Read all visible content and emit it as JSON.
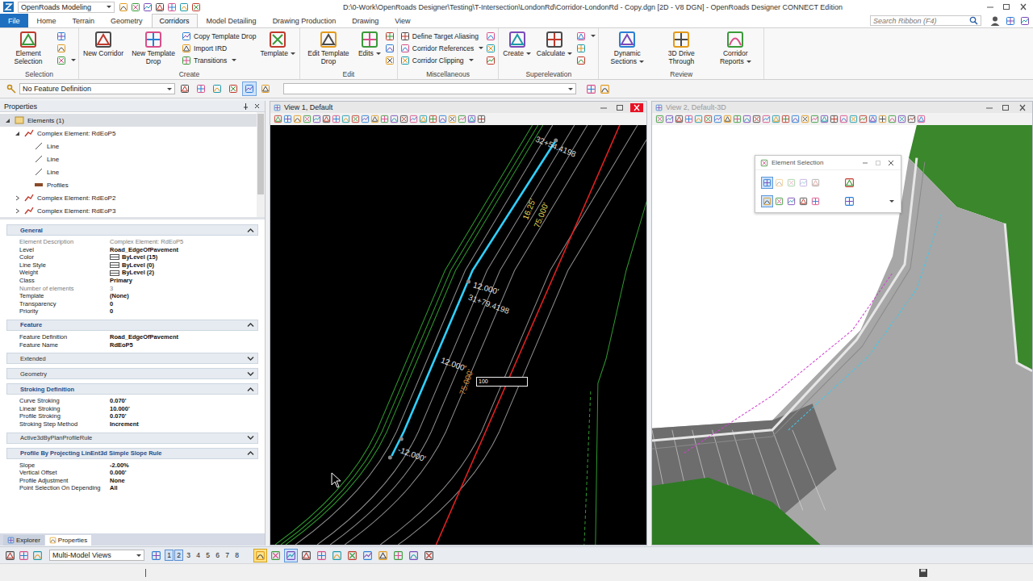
{
  "window": {
    "workflow": "OpenRoads Modeling",
    "title": "D:\\0-Work\\OpenRoads Designer\\Testing\\T-Intersection\\LondonRd\\Corridor-LondonRd - Copy.dgn [2D - V8 DGN] - OpenRoads Designer CONNECT Edition"
  },
  "ribbon_tabs": [
    {
      "label": "File",
      "kind": "file",
      "selected": false
    },
    {
      "label": "Home",
      "kind": "tab",
      "selected": false
    },
    {
      "label": "Terrain",
      "kind": "tab",
      "selected": false
    },
    {
      "label": "Geometry",
      "kind": "tab",
      "selected": false
    },
    {
      "label": "Corridors",
      "kind": "tab",
      "selected": true
    },
    {
      "label": "Model Detailing",
      "kind": "tab",
      "selected": false
    },
    {
      "label": "Drawing Production",
      "kind": "tab",
      "selected": false
    },
    {
      "label": "Drawing",
      "kind": "tab",
      "selected": false
    },
    {
      "label": "View",
      "kind": "tab",
      "selected": false
    }
  ],
  "search": {
    "placeholder": "Search Ribbon (F4)"
  },
  "ribbon_groups": [
    {
      "name": "Selection",
      "items": [
        {
          "kind": "large",
          "label": "Element Selection",
          "dropdown": false
        },
        {
          "kind": "icon",
          "label": "",
          "dropdown": false
        },
        {
          "kind": "icon",
          "label": "",
          "dropdown": false
        },
        {
          "kind": "icon",
          "label": "",
          "dropdown": true
        }
      ]
    },
    {
      "name": "Create",
      "items": [
        {
          "kind": "large",
          "label": "New Corridor",
          "dropdown": false
        },
        {
          "kind": "large",
          "label": "New Template Drop",
          "dropdown": false
        },
        {
          "kind": "small",
          "label": "Copy Template Drop",
          "dropdown": false
        },
        {
          "kind": "small",
          "label": "Import IRD",
          "dropdown": false
        },
        {
          "kind": "small",
          "label": "Transitions",
          "dropdown": true
        },
        {
          "kind": "large",
          "label": "Template",
          "dropdown": true
        }
      ]
    },
    {
      "name": "Edit",
      "items": [
        {
          "kind": "large",
          "label": "Edit Template Drop",
          "dropdown": false
        },
        {
          "kind": "large",
          "label": "Edits",
          "dropdown": true
        },
        {
          "kind": "icon",
          "label": "",
          "dropdown": false
        },
        {
          "kind": "icon",
          "label": "",
          "dropdown": false
        },
        {
          "kind": "icon",
          "label": "",
          "dropdown": false
        }
      ]
    },
    {
      "name": "Miscellaneous",
      "items": [
        {
          "kind": "small",
          "label": "Define Target Aliasing",
          "dropdown": false
        },
        {
          "kind": "small",
          "label": "Corridor References",
          "dropdown": true
        },
        {
          "kind": "small",
          "label": "Corridor Clipping",
          "dropdown": true
        },
        {
          "kind": "icon",
          "label": "",
          "dropdown": false
        },
        {
          "kind": "icon",
          "label": "",
          "dropdown": false
        },
        {
          "kind": "icon",
          "label": "",
          "dropdown": false
        }
      ]
    },
    {
      "name": "Superelevation",
      "items": [
        {
          "kind": "large",
          "label": "Create",
          "dropdown": true
        },
        {
          "kind": "large",
          "label": "Calculate",
          "dropdown": true
        },
        {
          "kind": "icon",
          "label": "",
          "dropdown": true
        },
        {
          "kind": "icon",
          "label": "",
          "dropdown": false
        },
        {
          "kind": "icon",
          "label": "",
          "dropdown": false
        }
      ]
    },
    {
      "name": "Review",
      "items": [
        {
          "kind": "large",
          "label": "Dynamic Sections",
          "dropdown": true
        },
        {
          "kind": "large",
          "label": "3D Drive Through",
          "dropdown": false
        },
        {
          "kind": "large",
          "label": "Corridor Reports",
          "dropdown": true
        }
      ]
    }
  ],
  "attribute_bar": {
    "feature_definition": "No Feature Definition",
    "field": ""
  },
  "properties_panel": {
    "title": "Properties",
    "tree": [
      {
        "label": "Elements (1)",
        "level": 0,
        "kind": "group",
        "expanded": true,
        "selected": true
      },
      {
        "label": "Complex Element: RdEoP5",
        "level": 1,
        "kind": "complex",
        "expanded": true,
        "selected": false
      },
      {
        "label": "Line",
        "level": 2,
        "kind": "line",
        "expanded": false,
        "selected": false
      },
      {
        "label": "Line",
        "level": 2,
        "kind": "line",
        "expanded": false,
        "selected": false
      },
      {
        "label": "Line",
        "level": 2,
        "kind": "line",
        "expanded": false,
        "selected": false
      },
      {
        "label": "Profiles",
        "level": 2,
        "kind": "profiles",
        "expanded": false,
        "selected": false
      },
      {
        "label": "Complex Element: RdEoP2",
        "level": 1,
        "kind": "complex",
        "expanded": false,
        "selected": false
      },
      {
        "label": "Complex Element: RdEoP3",
        "level": 1,
        "kind": "complex",
        "expanded": false,
        "selected": false
      }
    ],
    "sections": [
      {
        "title": "General",
        "expanded": true,
        "rows": [
          {
            "label": "Element Description",
            "value": "Complex Element: RdEoP5",
            "kind": "text",
            "greyed": true
          },
          {
            "label": "Level",
            "value": "Road_EdgeOfPavement",
            "kind": "text",
            "greyed": false
          },
          {
            "label": "Color",
            "value": "ByLevel (15)",
            "kind": "swatch",
            "greyed": false
          },
          {
            "label": "Line Style",
            "value": "ByLevel (0)",
            "kind": "swatch",
            "greyed": false
          },
          {
            "label": "Weight",
            "value": "ByLevel (2)",
            "kind": "swatch",
            "greyed": false
          },
          {
            "label": "Class",
            "value": "Primary",
            "kind": "text",
            "greyed": false
          },
          {
            "label": "Number of elements",
            "value": "3",
            "kind": "text",
            "greyed": true
          },
          {
            "label": "Template",
            "value": "(None)",
            "kind": "text",
            "greyed": false
          },
          {
            "label": "Transparency",
            "value": "0",
            "kind": "text",
            "greyed": false
          },
          {
            "label": "Priority",
            "value": "0",
            "kind": "text",
            "greyed": false
          }
        ]
      },
      {
        "title": "Feature",
        "expanded": true,
        "rows": [
          {
            "label": "Feature Definition",
            "value": "Road_EdgeOfPavement",
            "kind": "text",
            "greyed": false
          },
          {
            "label": "Feature Name",
            "value": "RdEoP5",
            "kind": "text",
            "greyed": false
          }
        ]
      },
      {
        "title": "Extended",
        "expanded": false,
        "rows": []
      },
      {
        "title": "Geometry",
        "expanded": false,
        "rows": []
      },
      {
        "title": "Stroking Definition",
        "expanded": true,
        "rows": [
          {
            "label": "Curve Stroking",
            "value": "0.070'",
            "kind": "text",
            "greyed": false
          },
          {
            "label": "Linear Stroking",
            "value": "10.000'",
            "kind": "text",
            "greyed": false
          },
          {
            "label": "Profile Stroking",
            "value": "0.070'",
            "kind": "text",
            "greyed": false
          },
          {
            "label": "Stroking Step Method",
            "value": "Increment",
            "kind": "text",
            "greyed": false
          }
        ]
      },
      {
        "title": "Active3dByPlanProfileRule",
        "expanded": false,
        "rows": []
      },
      {
        "title": "Profile By Projecting LinEnt3d Simple Slope Rule",
        "expanded": true,
        "rows": [
          {
            "label": "Slope",
            "value": "-2.00%",
            "kind": "text",
            "greyed": false
          },
          {
            "label": "Vertical Offset",
            "value": "0.000'",
            "kind": "text",
            "greyed": false
          },
          {
            "label": "Profile Adjustment",
            "value": "None",
            "kind": "text",
            "greyed": false
          },
          {
            "label": "Point Selection On Depending",
            "value": "All",
            "kind": "text",
            "greyed": false
          }
        ]
      }
    ],
    "tabs": [
      {
        "label": "Explorer",
        "selected": false
      },
      {
        "label": "Properties",
        "selected": true
      }
    ]
  },
  "view1": {
    "title": "View 1, Default",
    "active": true,
    "labels": [
      {
        "text": "32+54.4198",
        "color": "#dcdcd2"
      },
      {
        "text": "16.25'",
        "color": "#e6dc5a"
      },
      {
        "text": "75.000'",
        "color": "#e6dc5a"
      },
      {
        "text": "12.000'",
        "color": "#e8e8e8"
      },
      {
        "text": "31+79.4198",
        "color": "#dcdcd2"
      },
      {
        "text": "12.000'",
        "color": "#e8e8e8"
      },
      {
        "text": "75.000'",
        "color": "#d08a3a"
      },
      {
        "text": "-12.000'",
        "color": "#e8e8e8"
      }
    ],
    "input": {
      "value": "100"
    }
  },
  "view2": {
    "title": "View 2, Default-3D",
    "active": false
  },
  "element_selection": {
    "title": "Element Selection",
    "methods": [
      {
        "selected": true,
        "disabled": false
      },
      {
        "selected": false,
        "disabled": true
      },
      {
        "selected": false,
        "disabled": true
      },
      {
        "selected": false,
        "disabled": true
      },
      {
        "selected": false,
        "disabled": true
      }
    ],
    "modes": [
      {
        "selected": true,
        "disabled": false
      },
      {
        "selected": false,
        "disabled": false
      },
      {
        "selected": false,
        "disabled": false
      },
      {
        "selected": false,
        "disabled": false
      },
      {
        "selected": false,
        "disabled": false
      }
    ]
  },
  "bottom_toolbar": {
    "model_views": "Multi-Model Views",
    "views": [
      {
        "label": "1",
        "selected": true
      },
      {
        "label": "2",
        "selected": true
      },
      {
        "label": "3",
        "selected": false
      },
      {
        "label": "4",
        "selected": false
      },
      {
        "label": "5",
        "selected": false
      },
      {
        "label": "6",
        "selected": false
      },
      {
        "label": "7",
        "selected": false
      },
      {
        "label": "8",
        "selected": false
      }
    ],
    "tools": [
      {
        "selected": true
      },
      {
        "selected": false
      },
      {
        "selected": true
      },
      {
        "selected": false
      },
      {
        "selected": false
      },
      {
        "selected": false
      },
      {
        "selected": false
      },
      {
        "selected": false
      },
      {
        "selected": false
      },
      {
        "selected": false
      },
      {
        "selected": false
      },
      {
        "selected": false
      }
    ]
  }
}
